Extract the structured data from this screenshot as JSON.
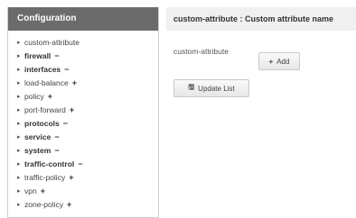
{
  "sidebar": {
    "title": "Configuration",
    "items": [
      {
        "label": "custom-attribute",
        "bold": false,
        "action": ""
      },
      {
        "label": "firewall",
        "bold": true,
        "action": "−"
      },
      {
        "label": "interfaces",
        "bold": true,
        "action": "−"
      },
      {
        "label": "load-balance",
        "bold": false,
        "action": "+"
      },
      {
        "label": "policy",
        "bold": false,
        "action": "+"
      },
      {
        "label": "port-forward",
        "bold": false,
        "action": "+"
      },
      {
        "label": "protocols",
        "bold": true,
        "action": "−"
      },
      {
        "label": "service",
        "bold": true,
        "action": "−"
      },
      {
        "label": "system",
        "bold": true,
        "action": "−"
      },
      {
        "label": "traffic-control",
        "bold": true,
        "action": "−"
      },
      {
        "label": "traffic-policy",
        "bold": false,
        "action": "+"
      },
      {
        "label": "vpn",
        "bold": false,
        "action": "+"
      },
      {
        "label": "zone-policy",
        "bold": false,
        "action": "+"
      }
    ]
  },
  "main": {
    "title": "custom-attribute : Custom attribute name",
    "field_label": "custom-attribute",
    "add_label": "Add",
    "add_icon": "+",
    "update_label": "Update List",
    "update_icon": "save-icon"
  }
}
